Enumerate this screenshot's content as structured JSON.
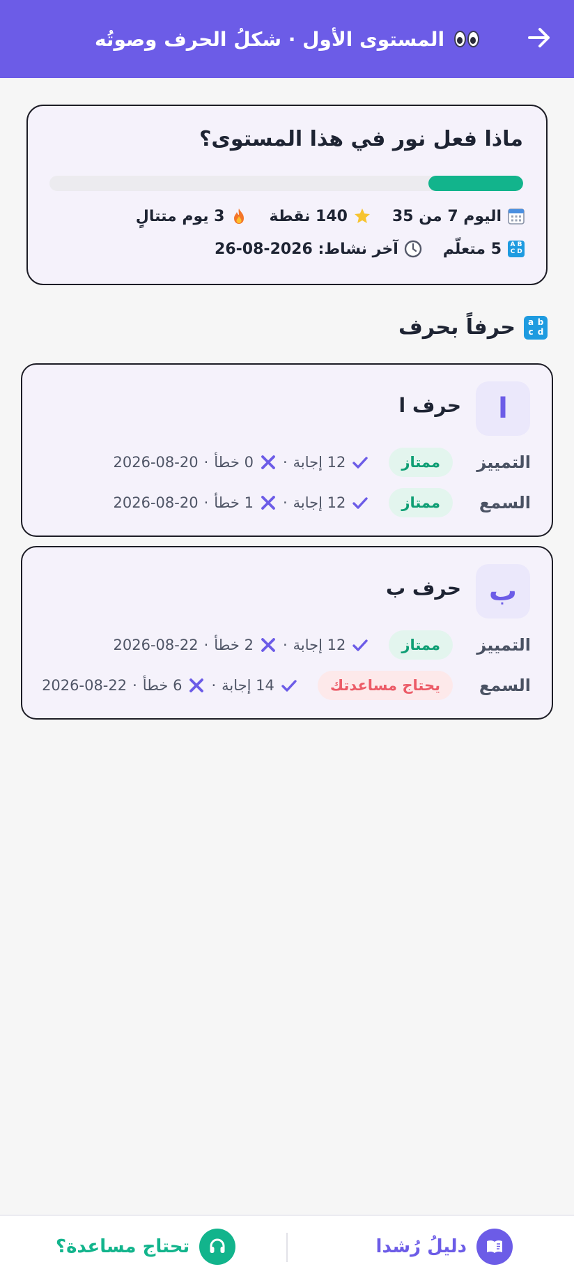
{
  "header": {
    "title": "المستوى الأول · شكلُ الحرف وصوتُه",
    "back_icon": "arrow-right-icon",
    "title_icon": "eyes-icon",
    "color": "#6c5ce7"
  },
  "summary": {
    "title": "ماذا فعل نور في هذا المستوى؟",
    "progress": 0.2,
    "day": "اليوم 7 من 35",
    "points": "140 نقطة",
    "streak": "3 يوم متتالٍ",
    "learned": "5 متعلّم",
    "last_activity": "آخر نشاط: 2026-08-26"
  },
  "section": {
    "title": "حرفاً بحرف",
    "icon": "abcd-icon"
  },
  "letters": [
    {
      "glyph": "ا",
      "name": "حرف ا",
      "skills": [
        {
          "label": "التمييز",
          "status": "ممتاز",
          "correct": "12 إجابة",
          "wrong": "0 خطأ",
          "date": "2026-08-20"
        },
        {
          "label": "السمع",
          "status": "ممتاز",
          "correct": "12 إجابة",
          "wrong": "1 خطأ",
          "date": "2026-08-20"
        }
      ]
    },
    {
      "glyph": "ب",
      "name": "حرف ب",
      "skills": [
        {
          "label": "التمييز",
          "status": "ممتاز",
          "correct": "12 إجابة",
          "wrong": "2 خطأ",
          "date": "2026-08-22"
        },
        {
          "label": "السمع",
          "status": "يحتاج مساعدتك",
          "correct": "14 إجابة",
          "wrong": "6 خطأ",
          "date": "2026-08-22"
        }
      ]
    }
  ],
  "bottom": {
    "guide_label": "دليلُ رُشدا",
    "help_label": "تحتاج مساعدة؟",
    "guide_icon": "book-icon",
    "help_icon": "headset-icon"
  },
  "colors": {
    "accent": "#6c5ce7",
    "success": "#12b48c",
    "danger": "#ec5b67"
  }
}
